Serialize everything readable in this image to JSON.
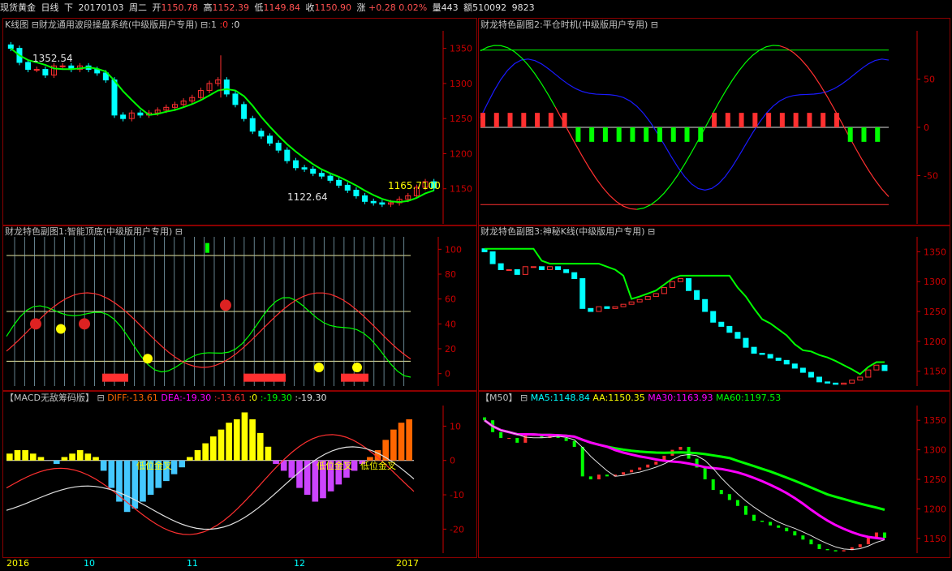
{
  "header": {
    "instrument": "现货黄金",
    "period": "日线",
    "direction": "下",
    "date": "20170103",
    "weekday": "周二",
    "open_label": "开",
    "open": "1150.78",
    "high_label": "高",
    "high": "1152.39",
    "low_label": "低",
    "low": "1149.84",
    "close_label": "收",
    "close": "1150.90",
    "change_label": "涨",
    "change": "+0.28",
    "change_pct": "0.02%",
    "volume_label": "量",
    "volume": "443",
    "amount_label": "额",
    "amount": "510092",
    "misc": "9823"
  },
  "panels": {
    "kline": {
      "title": "K线图 ⊟财龙通用波段操盘系统(中级版用户专用)",
      "ind1": "⊟:1",
      "ind2": ":0",
      "ind3": ":0"
    },
    "sub2": {
      "title": "财龙特色副图2:平仓时机(中级版用户专用) ⊟"
    },
    "sub1": {
      "title": "财龙特色副图1:智能顶底(中级版用户专用) ⊟"
    },
    "sub3": {
      "title": "财龙特色副图3:神秘K线(中级版用户专用) ⊟"
    },
    "macd": {
      "title": "【MACD无敌筹码版】 ⊟",
      "diff": "DIFF:-13.61",
      "dea": "DEA:-19.30",
      "v1": ":-13.61",
      "v2": ":0",
      "v3": ":-19.30",
      "v4": ":-19.30"
    },
    "ma": {
      "title": "【M50】 ⊟",
      "ma5": "MA5:1148.84",
      "aa": "AA:1150.35",
      "ma30": "MA30:1163.93",
      "ma60": "MA60:1197.53"
    }
  },
  "annotations": {
    "high_label": "1352.54",
    "low_label": "1122.64",
    "last_label": "1165.7100",
    "golden_cross_label": "低位金叉"
  },
  "x_labels": [
    "2016",
    "10",
    "11",
    "12",
    "2017"
  ],
  "colors": {
    "up": "#ff3030",
    "down": "#00ffff",
    "green": "#00ff00",
    "blue": "#1a1aff",
    "yellow": "#ffff00",
    "magenta": "#ff00ff",
    "axis": "#cc0000",
    "orange": "#ff6600"
  },
  "chart_data": [
    {
      "type": "line",
      "name": "kline",
      "ylim": [
        1100,
        1375
      ],
      "yticks": [
        1150,
        1200,
        1250,
        1300,
        1350
      ],
      "series": [
        {
          "name": "close",
          "values": [
            1350,
            1330,
            1320,
            1320,
            1312,
            1325,
            1325,
            1320,
            1325,
            1320,
            1315,
            1305,
            1255,
            1250,
            1258,
            1255,
            1258,
            1262,
            1266,
            1270,
            1275,
            1280,
            1290,
            1300,
            1305,
            1285,
            1270,
            1250,
            1232,
            1225,
            1215,
            1205,
            1190,
            1180,
            1178,
            1172,
            1168,
            1162,
            1155,
            1148,
            1140,
            1132,
            1130,
            1128,
            1130,
            1135,
            1140,
            1152,
            1160,
            1151
          ]
        }
      ]
    },
    {
      "type": "line",
      "name": "sub2",
      "ylim": [
        -100,
        100
      ],
      "yticks": [
        -50,
        0,
        50
      ]
    },
    {
      "type": "line",
      "name": "sub1",
      "ylim": [
        -10,
        110
      ],
      "yticks": [
        0,
        20,
        40,
        60,
        80,
        100
      ]
    },
    {
      "type": "line",
      "name": "sub3",
      "ylim": [
        1125,
        1375
      ],
      "yticks": [
        1150,
        1200,
        1250,
        1300,
        1350
      ]
    },
    {
      "type": "bar",
      "name": "macd",
      "ylim": [
        -27,
        16
      ],
      "yticks": [
        -20,
        -10,
        0,
        10
      ],
      "series": [
        {
          "name": "MACD",
          "values": [
            2,
            3,
            3,
            2,
            1,
            0,
            -1,
            1,
            2,
            3,
            2,
            1,
            -3,
            -8,
            -12,
            -15,
            -14,
            -12,
            -10,
            -8,
            -6,
            -4,
            -2,
            1,
            3,
            5,
            7,
            9,
            11,
            12,
            14,
            12,
            8,
            4,
            -1,
            -3,
            -5,
            -8,
            -10,
            -12,
            -11,
            -9,
            -7,
            -5,
            -3,
            -1,
            1,
            3,
            6,
            9,
            11,
            12
          ]
        }
      ]
    },
    {
      "type": "line",
      "name": "ma",
      "ylim": [
        1125,
        1375
      ],
      "yticks": [
        1150,
        1200,
        1250,
        1300,
        1350
      ]
    }
  ]
}
